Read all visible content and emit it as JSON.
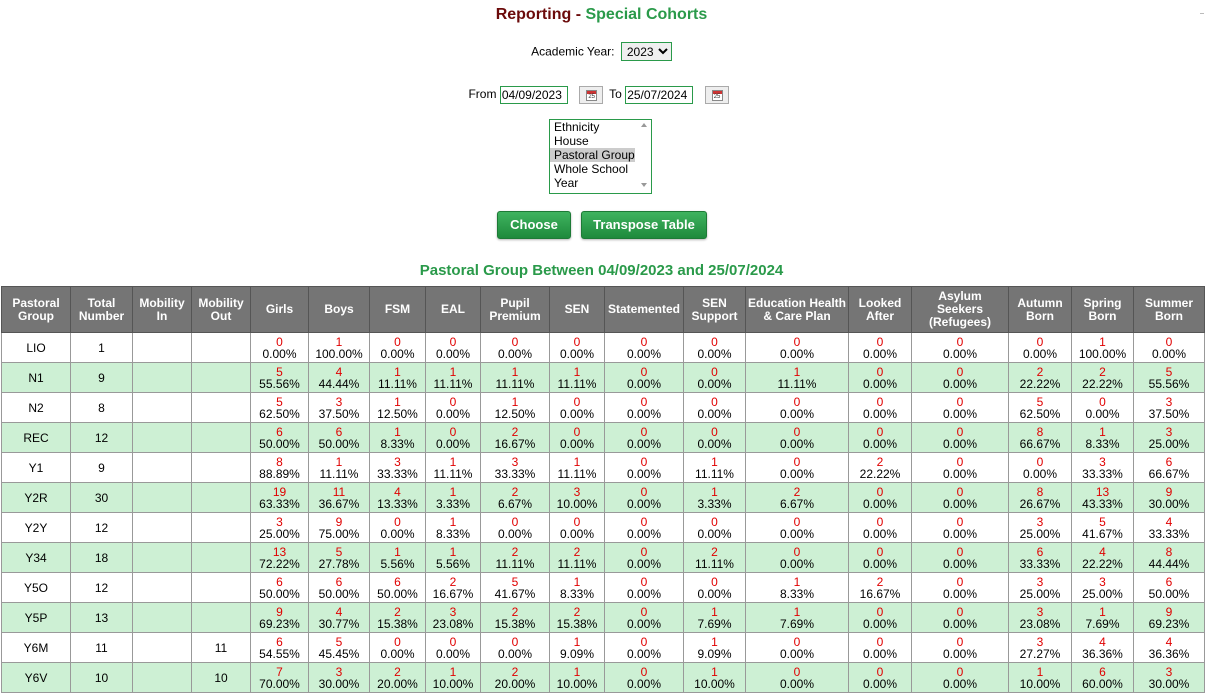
{
  "header": {
    "title_main": "Reporting",
    "title_sep": " - ",
    "title_sub": "Special Cohorts"
  },
  "academic_year": {
    "label": "Academic Year:",
    "selected": "2023"
  },
  "dates": {
    "from_label": "From",
    "from_value": "04/09/2023",
    "to_label": "To",
    "to_value": "25/07/2024",
    "calendar_digit": "25"
  },
  "group_list": {
    "options": [
      "Ethnicity",
      "House",
      "Pastoral Group",
      "Whole School",
      "Year"
    ],
    "selected_index": 2
  },
  "buttons": {
    "choose": "Choose",
    "transpose": "Transpose Table"
  },
  "report": {
    "title": "Pastoral Group Between 04/09/2023 and 25/07/2024",
    "columns": [
      "Pastoral Group",
      "Total Number",
      "Mobility In",
      "Mobility Out",
      "Girls",
      "Boys",
      "FSM",
      "EAL",
      "Pupil Premium",
      "SEN",
      "Statemented",
      "SEN Support",
      "Education Health & Care Plan",
      "Looked After",
      "Asylum Seekers (Refugees)",
      "Autumn Born",
      "Spring Born",
      "Summer Born"
    ],
    "rows": [
      {
        "group": "LIO",
        "total": "1",
        "mob_in": "",
        "mob_out": "",
        "cells": [
          [
            "0",
            "0.00%"
          ],
          [
            "1",
            "100.00%"
          ],
          [
            "0",
            "0.00%"
          ],
          [
            "0",
            "0.00%"
          ],
          [
            "0",
            "0.00%"
          ],
          [
            "0",
            "0.00%"
          ],
          [
            "0",
            "0.00%"
          ],
          [
            "0",
            "0.00%"
          ],
          [
            "0",
            "0.00%"
          ],
          [
            "0",
            "0.00%"
          ],
          [
            "0",
            "0.00%"
          ],
          [
            "0",
            "0.00%"
          ],
          [
            "1",
            "100.00%"
          ],
          [
            "0",
            "0.00%"
          ]
        ]
      },
      {
        "group": "N1",
        "total": "9",
        "mob_in": "",
        "mob_out": "",
        "cells": [
          [
            "5",
            "55.56%"
          ],
          [
            "4",
            "44.44%"
          ],
          [
            "1",
            "11.11%"
          ],
          [
            "1",
            "11.11%"
          ],
          [
            "1",
            "11.11%"
          ],
          [
            "1",
            "11.11%"
          ],
          [
            "0",
            "0.00%"
          ],
          [
            "0",
            "0.00%"
          ],
          [
            "1",
            "11.11%"
          ],
          [
            "0",
            "0.00%"
          ],
          [
            "0",
            "0.00%"
          ],
          [
            "2",
            "22.22%"
          ],
          [
            "2",
            "22.22%"
          ],
          [
            "5",
            "55.56%"
          ]
        ]
      },
      {
        "group": "N2",
        "total": "8",
        "mob_in": "",
        "mob_out": "",
        "cells": [
          [
            "5",
            "62.50%"
          ],
          [
            "3",
            "37.50%"
          ],
          [
            "1",
            "12.50%"
          ],
          [
            "0",
            "0.00%"
          ],
          [
            "1",
            "12.50%"
          ],
          [
            "0",
            "0.00%"
          ],
          [
            "0",
            "0.00%"
          ],
          [
            "0",
            "0.00%"
          ],
          [
            "0",
            "0.00%"
          ],
          [
            "0",
            "0.00%"
          ],
          [
            "0",
            "0.00%"
          ],
          [
            "5",
            "62.50%"
          ],
          [
            "0",
            "0.00%"
          ],
          [
            "3",
            "37.50%"
          ]
        ]
      },
      {
        "group": "REC",
        "total": "12",
        "mob_in": "",
        "mob_out": "",
        "cells": [
          [
            "6",
            "50.00%"
          ],
          [
            "6",
            "50.00%"
          ],
          [
            "1",
            "8.33%"
          ],
          [
            "0",
            "0.00%"
          ],
          [
            "2",
            "16.67%"
          ],
          [
            "0",
            "0.00%"
          ],
          [
            "0",
            "0.00%"
          ],
          [
            "0",
            "0.00%"
          ],
          [
            "0",
            "0.00%"
          ],
          [
            "0",
            "0.00%"
          ],
          [
            "0",
            "0.00%"
          ],
          [
            "8",
            "66.67%"
          ],
          [
            "1",
            "8.33%"
          ],
          [
            "3",
            "25.00%"
          ]
        ]
      },
      {
        "group": "Y1",
        "total": "9",
        "mob_in": "",
        "mob_out": "",
        "cells": [
          [
            "8",
            "88.89%"
          ],
          [
            "1",
            "11.11%"
          ],
          [
            "3",
            "33.33%"
          ],
          [
            "1",
            "11.11%"
          ],
          [
            "3",
            "33.33%"
          ],
          [
            "1",
            "11.11%"
          ],
          [
            "0",
            "0.00%"
          ],
          [
            "1",
            "11.11%"
          ],
          [
            "0",
            "0.00%"
          ],
          [
            "2",
            "22.22%"
          ],
          [
            "0",
            "0.00%"
          ],
          [
            "0",
            "0.00%"
          ],
          [
            "3",
            "33.33%"
          ],
          [
            "6",
            "66.67%"
          ]
        ]
      },
      {
        "group": "Y2R",
        "total": "30",
        "mob_in": "",
        "mob_out": "",
        "cells": [
          [
            "19",
            "63.33%"
          ],
          [
            "11",
            "36.67%"
          ],
          [
            "4",
            "13.33%"
          ],
          [
            "1",
            "3.33%"
          ],
          [
            "2",
            "6.67%"
          ],
          [
            "3",
            "10.00%"
          ],
          [
            "0",
            "0.00%"
          ],
          [
            "1",
            "3.33%"
          ],
          [
            "2",
            "6.67%"
          ],
          [
            "0",
            "0.00%"
          ],
          [
            "0",
            "0.00%"
          ],
          [
            "8",
            "26.67%"
          ],
          [
            "13",
            "43.33%"
          ],
          [
            "9",
            "30.00%"
          ]
        ]
      },
      {
        "group": "Y2Y",
        "total": "12",
        "mob_in": "",
        "mob_out": "",
        "cells": [
          [
            "3",
            "25.00%"
          ],
          [
            "9",
            "75.00%"
          ],
          [
            "0",
            "0.00%"
          ],
          [
            "1",
            "8.33%"
          ],
          [
            "0",
            "0.00%"
          ],
          [
            "0",
            "0.00%"
          ],
          [
            "0",
            "0.00%"
          ],
          [
            "0",
            "0.00%"
          ],
          [
            "0",
            "0.00%"
          ],
          [
            "0",
            "0.00%"
          ],
          [
            "0",
            "0.00%"
          ],
          [
            "3",
            "25.00%"
          ],
          [
            "5",
            "41.67%"
          ],
          [
            "4",
            "33.33%"
          ]
        ]
      },
      {
        "group": "Y34",
        "total": "18",
        "mob_in": "",
        "mob_out": "",
        "cells": [
          [
            "13",
            "72.22%"
          ],
          [
            "5",
            "27.78%"
          ],
          [
            "1",
            "5.56%"
          ],
          [
            "1",
            "5.56%"
          ],
          [
            "2",
            "11.11%"
          ],
          [
            "2",
            "11.11%"
          ],
          [
            "0",
            "0.00%"
          ],
          [
            "2",
            "11.11%"
          ],
          [
            "0",
            "0.00%"
          ],
          [
            "0",
            "0.00%"
          ],
          [
            "0",
            "0.00%"
          ],
          [
            "6",
            "33.33%"
          ],
          [
            "4",
            "22.22%"
          ],
          [
            "8",
            "44.44%"
          ]
        ]
      },
      {
        "group": "Y5O",
        "total": "12",
        "mob_in": "",
        "mob_out": "",
        "cells": [
          [
            "6",
            "50.00%"
          ],
          [
            "6",
            "50.00%"
          ],
          [
            "6",
            "50.00%"
          ],
          [
            "2",
            "16.67%"
          ],
          [
            "5",
            "41.67%"
          ],
          [
            "1",
            "8.33%"
          ],
          [
            "0",
            "0.00%"
          ],
          [
            "0",
            "0.00%"
          ],
          [
            "1",
            "8.33%"
          ],
          [
            "2",
            "16.67%"
          ],
          [
            "0",
            "0.00%"
          ],
          [
            "3",
            "25.00%"
          ],
          [
            "3",
            "25.00%"
          ],
          [
            "6",
            "50.00%"
          ]
        ]
      },
      {
        "group": "Y5P",
        "total": "13",
        "mob_in": "",
        "mob_out": "",
        "cells": [
          [
            "9",
            "69.23%"
          ],
          [
            "4",
            "30.77%"
          ],
          [
            "2",
            "15.38%"
          ],
          [
            "3",
            "23.08%"
          ],
          [
            "2",
            "15.38%"
          ],
          [
            "2",
            "15.38%"
          ],
          [
            "0",
            "0.00%"
          ],
          [
            "1",
            "7.69%"
          ],
          [
            "1",
            "7.69%"
          ],
          [
            "0",
            "0.00%"
          ],
          [
            "0",
            "0.00%"
          ],
          [
            "3",
            "23.08%"
          ],
          [
            "1",
            "7.69%"
          ],
          [
            "9",
            "69.23%"
          ]
        ]
      },
      {
        "group": "Y6M",
        "total": "11",
        "mob_in": "",
        "mob_out": "11",
        "cells": [
          [
            "6",
            "54.55%"
          ],
          [
            "5",
            "45.45%"
          ],
          [
            "0",
            "0.00%"
          ],
          [
            "0",
            "0.00%"
          ],
          [
            "0",
            "0.00%"
          ],
          [
            "1",
            "9.09%"
          ],
          [
            "0",
            "0.00%"
          ],
          [
            "1",
            "9.09%"
          ],
          [
            "0",
            "0.00%"
          ],
          [
            "0",
            "0.00%"
          ],
          [
            "0",
            "0.00%"
          ],
          [
            "3",
            "27.27%"
          ],
          [
            "4",
            "36.36%"
          ],
          [
            "4",
            "36.36%"
          ]
        ]
      },
      {
        "group": "Y6V",
        "total": "10",
        "mob_in": "",
        "mob_out": "10",
        "cells": [
          [
            "7",
            "70.00%"
          ],
          [
            "3",
            "30.00%"
          ],
          [
            "2",
            "20.00%"
          ],
          [
            "1",
            "10.00%"
          ],
          [
            "2",
            "20.00%"
          ],
          [
            "1",
            "10.00%"
          ],
          [
            "0",
            "0.00%"
          ],
          [
            "1",
            "10.00%"
          ],
          [
            "0",
            "0.00%"
          ],
          [
            "0",
            "0.00%"
          ],
          [
            "0",
            "0.00%"
          ],
          [
            "1",
            "10.00%"
          ],
          [
            "6",
            "60.00%"
          ],
          [
            "3",
            "30.00%"
          ]
        ]
      }
    ]
  }
}
